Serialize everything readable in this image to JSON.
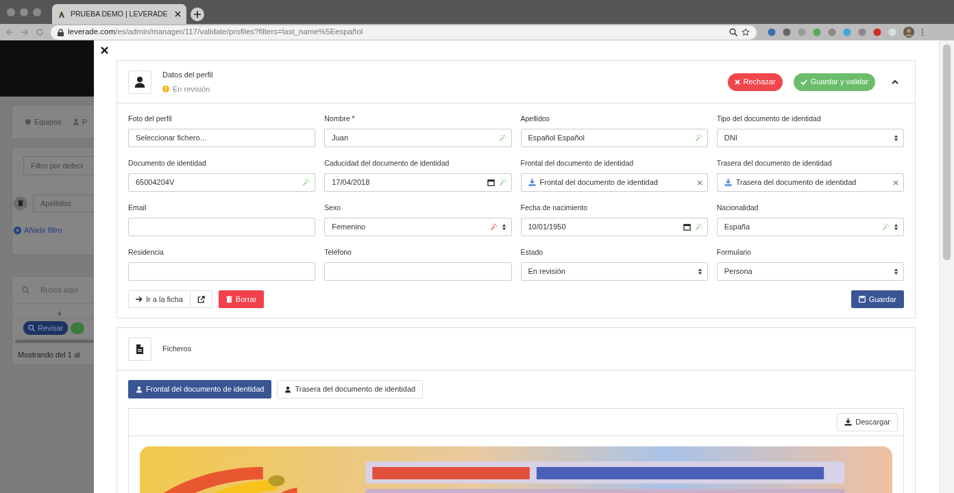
{
  "browser": {
    "tab_title": "PRUEBA DEMO | LEVERADE",
    "url_host": "leverade.com",
    "url_path": "/es/admin/manager/117/validate/profiles?filters=last_name%5Eespañol"
  },
  "background_page": {
    "nav_items": [
      "Equipos",
      "P"
    ],
    "filter_select": "Filtro por defect",
    "filter_field": "Apellidos",
    "add_filter": "Añadir filtro",
    "search_placeholder": "Busca aquí",
    "review_button": "Revisar",
    "footer": "Mostrando del 1 al"
  },
  "profile_card": {
    "title": "Datos del perfil",
    "status": "En revisión",
    "expanded": true,
    "reject_button": "Rechazar",
    "validate_button": "Guardar y validar",
    "fields": [
      {
        "label": "Foto del perfil",
        "kind": "file",
        "value": "Seleccionar fichero…"
      },
      {
        "label": "Nombre *",
        "kind": "text",
        "value": "Juan",
        "verified": true
      },
      {
        "label": "Apellidos",
        "kind": "text",
        "value": "Español Español",
        "verified": true
      },
      {
        "label": "Tipo del documento de identidad",
        "kind": "select",
        "value": "DNI"
      },
      {
        "label": "Documento de identidad",
        "kind": "text",
        "value": "65004204V",
        "verified": true
      },
      {
        "label": "Caducidad del documento de identidad",
        "kind": "date",
        "value": "17/04/2018",
        "verified": true
      },
      {
        "label": "Frontal del documento de identidad",
        "kind": "document",
        "value": "Frontal del documento de identidad"
      },
      {
        "label": "Trasera del documento de identidad",
        "kind": "document",
        "value": "Trasera del documento de identidad"
      },
      {
        "label": "Email",
        "kind": "text"
      },
      {
        "label": "Sexo",
        "kind": "select",
        "value": "Femenino",
        "verified": false
      },
      {
        "label": "Fecha de nacimiento",
        "kind": "date",
        "value": "10/01/1950",
        "verified": true
      },
      {
        "label": "Nacionalidad",
        "kind": "select",
        "value": "España",
        "verified": true
      },
      {
        "label": "Residencia",
        "kind": "text"
      },
      {
        "label": "Teléfono",
        "kind": "text"
      },
      {
        "label": "Estado",
        "kind": "select",
        "value": "En revisión"
      },
      {
        "label": "Formulario",
        "kind": "select",
        "value": "Persona"
      }
    ],
    "go_button": "Ir a la ficha",
    "delete_button": "Borrar",
    "save_button": "Guardar"
  },
  "files_card": {
    "title": "Ficheros",
    "tabs": [
      {
        "label": "Frontal del documento de identidad",
        "selected": true
      },
      {
        "label": "Trasera del documento de identidad",
        "selected": false
      }
    ],
    "download_button": "Descargar"
  }
}
